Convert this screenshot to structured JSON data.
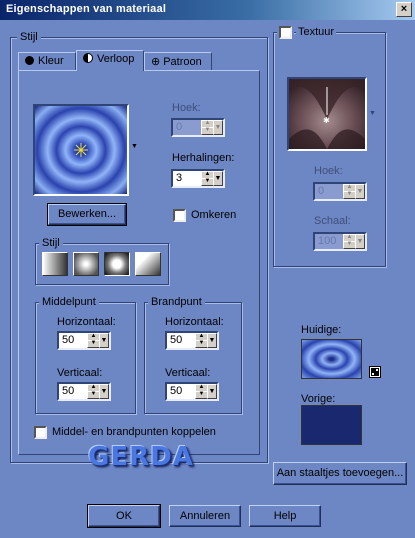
{
  "window": {
    "title": "Eigenschappen van materiaal",
    "close_glyph": "×"
  },
  "left_group": {
    "label": "Stijl"
  },
  "tabs": [
    {
      "label": "Kleur",
      "icon": "filled-circle-icon"
    },
    {
      "label": "Verloop",
      "icon": "half-circle-icon"
    },
    {
      "label": "Patroon",
      "icon": "pattern-icon"
    }
  ],
  "gradient": {
    "edit_button": "Bewerken...",
    "angle_label": "Hoek:",
    "angle_value": "0",
    "repeats_label": "Herhalingen:",
    "repeats_value": "3",
    "invert_label": "Omkeren",
    "invert_checked": false,
    "style_label": "Stijl",
    "styles": [
      "linear",
      "rectangular",
      "sunburst",
      "radial"
    ],
    "center_label": "Middelpunt",
    "center_h_label": "Horizontaal:",
    "center_h_value": "50",
    "center_v_label": "Verticaal:",
    "center_v_value": "50",
    "focus_label": "Brandpunt",
    "focus_h_label": "Horizontaal:",
    "focus_h_value": "50",
    "focus_v_label": "Verticaal:",
    "focus_v_value": "50",
    "link_label": "Middel- en brandpunten koppelen",
    "link_checked": false
  },
  "texture": {
    "label": "Textuur",
    "checked": false,
    "angle_label": "Hoek:",
    "angle_value": "0",
    "scale_label": "Schaal:",
    "scale_value": "100"
  },
  "current_label": "Huidige:",
  "previous_label": "Vorige:",
  "add_swatch_button": "Aan staaltjes toevoegen...",
  "watermark": "GERDA",
  "footer": {
    "ok": "OK",
    "cancel": "Annuleren",
    "help": "Help"
  },
  "colors": {
    "dialog_bg": "#6d86c4",
    "gradient_dark": "#1e2f8a",
    "gradient_light": "#8fb1f5",
    "previous_swatch": "#1a2870"
  }
}
